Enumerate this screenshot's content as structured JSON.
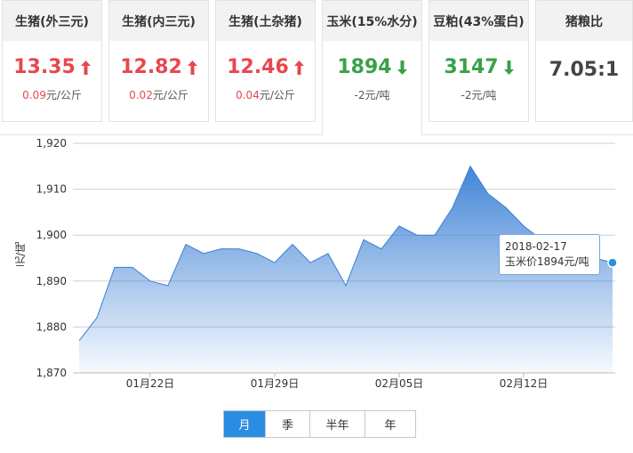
{
  "cards": [
    {
      "label": "生猪(外三元)",
      "price": "13.35",
      "direction": "up",
      "change_num": "0.09",
      "change_unit": "元/公斤"
    },
    {
      "label": "生猪(内三元)",
      "price": "12.82",
      "direction": "up",
      "change_num": "0.02",
      "change_unit": "元/公斤"
    },
    {
      "label": "生猪(土杂猪)",
      "price": "12.46",
      "direction": "up",
      "change_num": "0.04",
      "change_unit": "元/公斤"
    },
    {
      "label": "玉米(15%水分)",
      "price": "1894",
      "direction": "down",
      "change_num": "-2",
      "change_unit": "元/吨"
    },
    {
      "label": "豆粕(43%蛋白)",
      "price": "3147",
      "direction": "down",
      "change_num": "-2",
      "change_unit": "元/吨"
    },
    {
      "label": "猪粮比",
      "ratio": "7.05:1"
    }
  ],
  "colors": {
    "up": "#e8474f",
    "down": "#3aa146",
    "accent": "#2a8de3",
    "line": "#3a7fd5"
  },
  "icons": {
    "up": "arrow-up-icon",
    "down": "arrow-down-icon"
  },
  "tooltip": {
    "date": "2018-02-17",
    "text": "玉米价1894元/吨"
  },
  "range_buttons": [
    "月",
    "季",
    "半年",
    "年"
  ],
  "active_range": "月",
  "chart_data": {
    "type": "area",
    "ylabel": "元/吨",
    "xlabel": "",
    "ylim": [
      1870,
      1920
    ],
    "yticks": [
      "1,870",
      "1,880",
      "1,890",
      "1,900",
      "1,910",
      "1,920"
    ],
    "ytick_values": [
      1870,
      1880,
      1890,
      1900,
      1910,
      1920
    ],
    "grid": true,
    "x": [
      "01-18",
      "01-19",
      "01-20",
      "01-21",
      "01-22",
      "01-23",
      "01-24",
      "01-25",
      "01-26",
      "01-27",
      "01-28",
      "01-29",
      "01-30",
      "01-31",
      "02-01",
      "02-02",
      "02-03",
      "02-04",
      "02-05",
      "02-06",
      "02-07",
      "02-08",
      "02-09",
      "02-10",
      "02-11",
      "02-12",
      "02-13",
      "02-14",
      "02-15",
      "02-16",
      "02-17"
    ],
    "values": [
      1877,
      1882,
      1893,
      1893,
      1890,
      1889,
      1898,
      1896,
      1897,
      1897,
      1896,
      1894,
      1898,
      1894,
      1896,
      1889,
      1899,
      1897,
      1902,
      1900,
      1900,
      1906,
      1915,
      1909,
      1906,
      1902,
      1899,
      1897,
      1895,
      1895,
      1894
    ],
    "xtick_labels": [
      {
        "label": "01月22日",
        "index": 4
      },
      {
        "label": "01月29日",
        "index": 11
      },
      {
        "label": "02月05日",
        "index": 18
      },
      {
        "label": "02月12日",
        "index": 25
      }
    ],
    "highlight_index": 30
  }
}
